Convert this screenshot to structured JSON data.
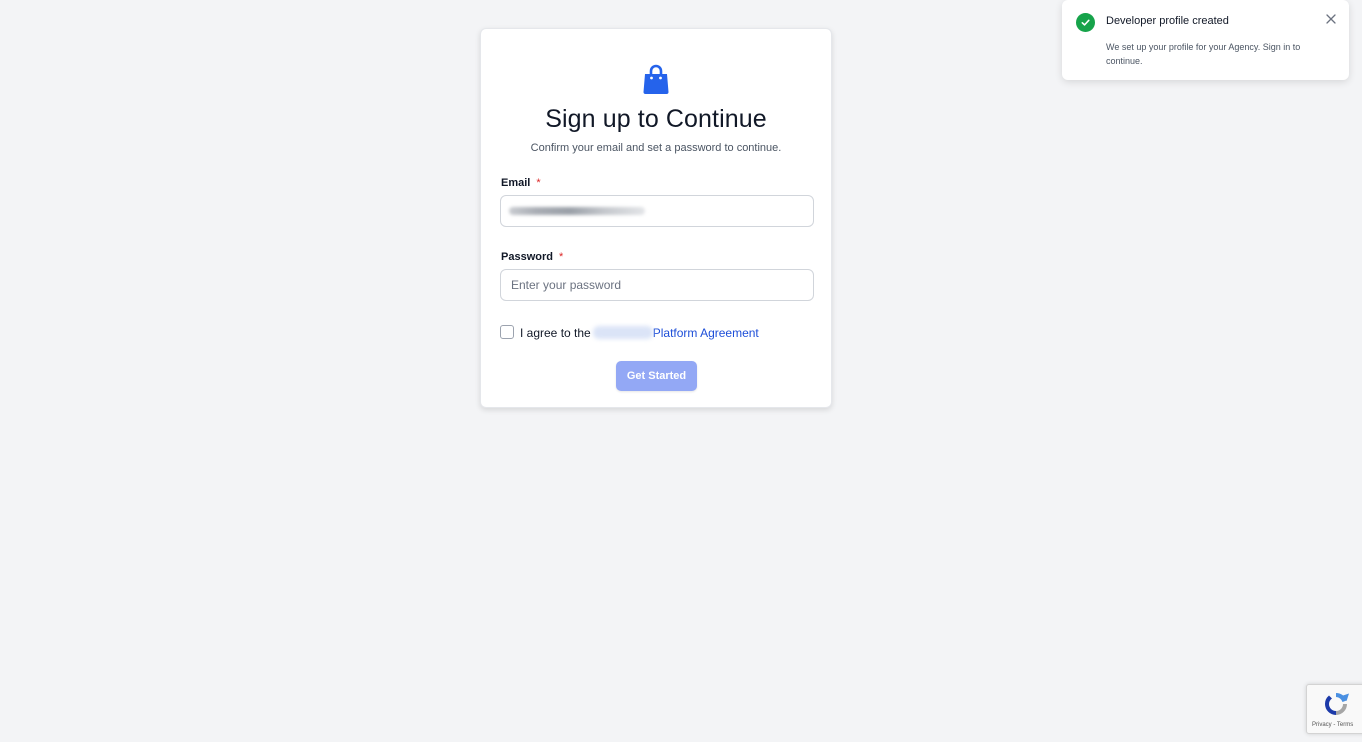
{
  "card": {
    "title": "Sign up to Continue",
    "subtitle": "Confirm your email and set a password to continue.",
    "email_label": "Email",
    "email_required": "*",
    "password_label": "Password",
    "password_required": "*",
    "password_placeholder": "Enter your password",
    "agree_prefix": "I agree to the",
    "agree_link": "Platform Agreement",
    "submit_label": "Get Started"
  },
  "toast": {
    "title": "Developer profile created",
    "body": "We set up your profile for your Agency. Sign in to continue."
  },
  "recaptcha": {
    "privacy": "Privacy",
    "separator": " - ",
    "terms": "Terms"
  },
  "colors": {
    "accent": "#2563eb",
    "button_disabled": "#93a8f5",
    "success": "#16a34a",
    "required": "#dc2626",
    "link": "#1d4ed8"
  },
  "icons": {
    "logo": "shopping-bag-icon",
    "toast_status": "check-circle-icon",
    "toast_close": "close-icon",
    "recaptcha": "recaptcha-icon"
  }
}
